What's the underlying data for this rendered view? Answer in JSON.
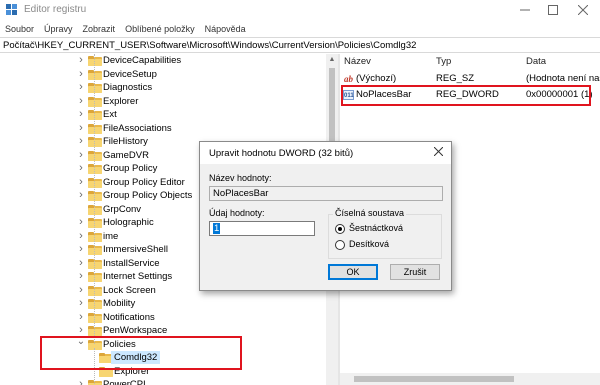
{
  "window": {
    "title": "Editor registru",
    "icon": "regedit-icon"
  },
  "menu": [
    "Soubor",
    "Úpravy",
    "Zobrazit",
    "Oblíbené položky",
    "Nápověda"
  ],
  "address": "Počítač\\HKEY_CURRENT_USER\\Software\\Microsoft\\Windows\\CurrentVersion\\Policies\\Comdlg32",
  "tree": {
    "items": [
      {
        "label": "DeviceCapabilities",
        "expandable": true
      },
      {
        "label": "DeviceSetup",
        "expandable": true
      },
      {
        "label": "Diagnostics",
        "expandable": true
      },
      {
        "label": "Explorer",
        "expandable": true
      },
      {
        "label": "Ext",
        "expandable": true
      },
      {
        "label": "FileAssociations",
        "expandable": true
      },
      {
        "label": "FileHistory",
        "expandable": true
      },
      {
        "label": "GameDVR",
        "expandable": true
      },
      {
        "label": "Group Policy",
        "expandable": true
      },
      {
        "label": "Group Policy Editor",
        "expandable": true
      },
      {
        "label": "Group Policy Objects",
        "expandable": true
      },
      {
        "label": "GrpConv",
        "expandable": false
      },
      {
        "label": "Holographic",
        "expandable": true
      },
      {
        "label": "ime",
        "expandable": true
      },
      {
        "label": "ImmersiveShell",
        "expandable": true
      },
      {
        "label": "InstallService",
        "expandable": true
      },
      {
        "label": "Internet Settings",
        "expandable": true
      },
      {
        "label": "Lock Screen",
        "expandable": true
      },
      {
        "label": "Mobility",
        "expandable": true
      },
      {
        "label": "Notifications",
        "expandable": true
      },
      {
        "label": "PenWorkspace",
        "expandable": true
      },
      {
        "label": "Policies",
        "expandable": true,
        "expanded": true
      },
      {
        "label": "Comdlg32",
        "child": true,
        "selected": true
      },
      {
        "label": "Explorer",
        "child": true
      },
      {
        "label": "PowerCPL",
        "expandable": true
      }
    ]
  },
  "values": {
    "headers": {
      "name": "Název",
      "type": "Typ",
      "data": "Data"
    },
    "rows": [
      {
        "icon": "string-value-icon",
        "glyph": "ab",
        "name": "(Výchozí)",
        "type": "REG_SZ",
        "data": "(Hodnota není nas"
      },
      {
        "icon": "binary-value-icon",
        "glyph": "011",
        "name": "NoPlacesBar",
        "type": "REG_DWORD",
        "data": "0x00000001 (1)"
      }
    ]
  },
  "dialog": {
    "title": "Upravit hodnotu DWORD (32 bitů)",
    "name_label": "Název hodnoty:",
    "name_value": "NoPlacesBar",
    "data_label": "Údaj hodnoty:",
    "data_value": "1",
    "base_title": "Číselná soustava",
    "radios": [
      {
        "label": "Šestnáctková",
        "checked": true
      },
      {
        "label": "Desítková",
        "checked": false
      }
    ],
    "ok": "OK",
    "cancel": "Zrušit"
  },
  "colors": {
    "highlight": "#e0141e",
    "selection": "#cce8ff",
    "folder": "#f7d571"
  }
}
